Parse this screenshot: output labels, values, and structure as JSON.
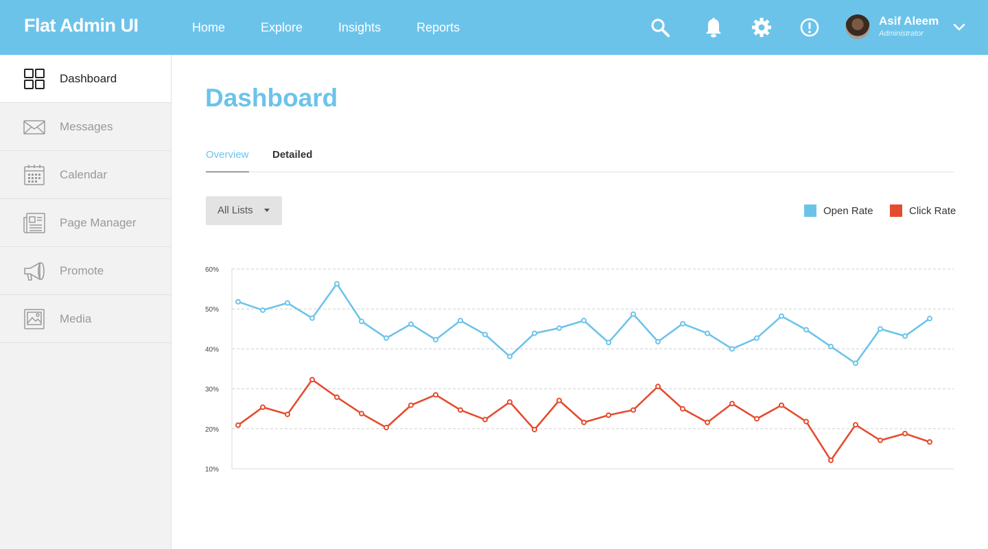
{
  "app": {
    "brand": "Flat Admin UI"
  },
  "topnav": {
    "items": [
      "Home",
      "Explore",
      "Insights",
      "Reports"
    ]
  },
  "toolbar_icons": [
    "search-icon",
    "bell-icon",
    "gear-icon",
    "alert-icon"
  ],
  "user": {
    "name": "Asif Aleem",
    "role": "Administrator"
  },
  "sidebar": {
    "items": [
      {
        "label": "Dashboard",
        "icon": "grid-icon",
        "active": true
      },
      {
        "label": "Messages",
        "icon": "envelope-icon"
      },
      {
        "label": "Calendar",
        "icon": "calendar-icon"
      },
      {
        "label": "Page Manager",
        "icon": "newspaper-icon"
      },
      {
        "label": "Promote",
        "icon": "megaphone-icon"
      },
      {
        "label": "Media",
        "icon": "image-icon"
      }
    ]
  },
  "main": {
    "title": "Dashboard",
    "tabs": [
      {
        "label": "Overview",
        "active": true
      },
      {
        "label": "Detailed"
      }
    ],
    "filter": {
      "selected": "All Lists"
    }
  },
  "colors": {
    "accent": "#6cc3ea",
    "open_rate": "#6cc3ea",
    "click_rate": "#e54b2e"
  },
  "chart_data": {
    "type": "line",
    "title": "",
    "xlabel": "",
    "ylabel": "",
    "ylim": [
      10,
      60
    ],
    "yticks": [
      "10%",
      "20%",
      "30%",
      "40%",
      "50%",
      "60%"
    ],
    "grid": true,
    "legend": "top-right",
    "x": [
      1,
      2,
      3,
      4,
      5,
      6,
      7,
      8,
      9,
      10,
      11,
      12,
      13,
      14,
      15,
      16,
      17,
      18,
      19,
      20,
      21,
      22,
      23,
      24,
      25,
      26,
      27,
      28,
      29
    ],
    "series": [
      {
        "name": "Open Rate",
        "color": "#6cc3ea",
        "values": [
          51.8,
          49.7,
          51.5,
          47.7,
          56.3,
          46.9,
          42.7,
          46.2,
          42.3,
          47.1,
          43.6,
          38.1,
          43.9,
          45.2,
          47.1,
          41.6,
          48.7,
          41.8,
          46.3,
          43.9,
          40.0,
          42.7,
          48.2,
          44.8,
          40.6,
          36.4,
          45.0,
          43.2,
          47.6
        ]
      },
      {
        "name": "Click Rate",
        "color": "#e54b2e",
        "values": [
          20.9,
          25.4,
          23.6,
          32.3,
          27.9,
          23.8,
          20.3,
          25.9,
          28.5,
          24.7,
          22.3,
          26.7,
          19.8,
          27.1,
          21.6,
          23.4,
          24.7,
          30.6,
          25.0,
          21.6,
          26.3,
          22.5,
          25.9,
          21.8,
          12.1,
          21.0,
          17.1,
          18.8,
          16.7
        ]
      }
    ]
  }
}
